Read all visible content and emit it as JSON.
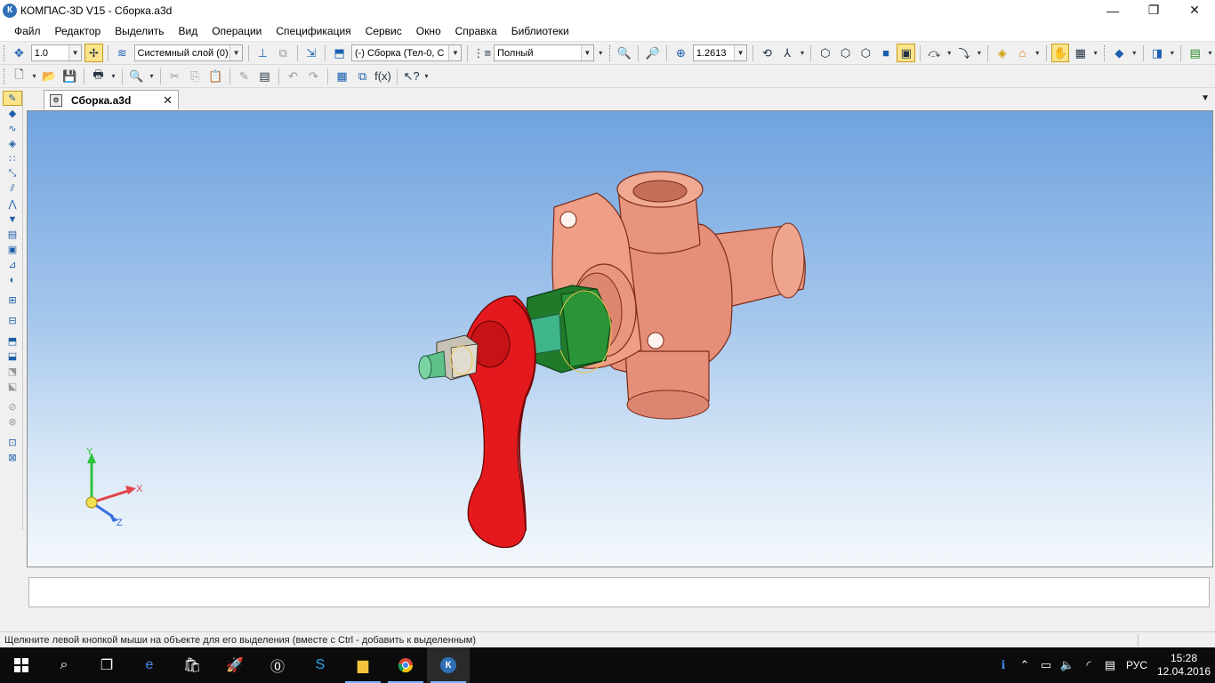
{
  "window": {
    "title": "КОМПАС-3D V15 - Сборка.a3d",
    "app_icon": "К",
    "minimize": "—",
    "maximize": "❐",
    "close": "✕"
  },
  "menu": [
    "Файл",
    "Редактор",
    "Выделить",
    "Вид",
    "Операции",
    "Спецификация",
    "Сервис",
    "Окно",
    "Справка",
    "Библиотеки"
  ],
  "toolbar1": {
    "step_value": "1.0",
    "layer_value": "Системный слой (0)",
    "assembly_value": "(-) Сборка (Тел-0, С",
    "display_mode_value": "Полный",
    "zoom_value": "1.2613"
  },
  "document_tab": {
    "label": "Сборка.a3d",
    "close": "✕",
    "dropdown": "▼"
  },
  "axes": {
    "x": "X",
    "y": "Y",
    "z": "Z"
  },
  "status": {
    "hint": "Щелкните левой кнопкой мыши на объекте для его выделения (вместе с Ctrl - добавить к выделенным)"
  },
  "taskbar": {
    "language": "РУС",
    "time": "15:28",
    "date": "12.04.2016"
  },
  "colors": {
    "handle": "#e4191d",
    "body": "#e58e78",
    "nut": "#1f7a2a",
    "stem": "#3fb58a",
    "viewport_top": "#6fa3df",
    "viewport_bottom": "#f4f8fc"
  }
}
